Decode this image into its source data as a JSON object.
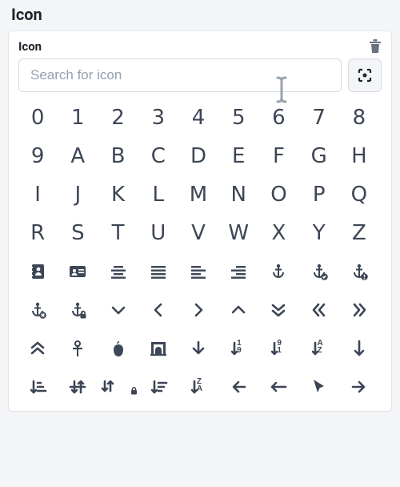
{
  "section": {
    "title": "Icon"
  },
  "panel": {
    "label": "Icon"
  },
  "search": {
    "placeholder": "Search for icon",
    "value": ""
  },
  "colors": {
    "icon": "#3d4656"
  },
  "icons": [
    {
      "name": "digit-0",
      "kind": "glyph",
      "glyph": "0"
    },
    {
      "name": "digit-1",
      "kind": "glyph",
      "glyph": "1"
    },
    {
      "name": "digit-2",
      "kind": "glyph",
      "glyph": "2"
    },
    {
      "name": "digit-3",
      "kind": "glyph",
      "glyph": "3"
    },
    {
      "name": "digit-4",
      "kind": "glyph",
      "glyph": "4"
    },
    {
      "name": "digit-5",
      "kind": "glyph",
      "glyph": "5"
    },
    {
      "name": "digit-6",
      "kind": "glyph",
      "glyph": "6"
    },
    {
      "name": "digit-7",
      "kind": "glyph",
      "glyph": "7"
    },
    {
      "name": "digit-8",
      "kind": "glyph",
      "glyph": "8"
    },
    {
      "name": "digit-9",
      "kind": "glyph",
      "glyph": "9"
    },
    {
      "name": "letter-a",
      "kind": "glyph",
      "glyph": "A"
    },
    {
      "name": "letter-b",
      "kind": "glyph",
      "glyph": "B"
    },
    {
      "name": "letter-c",
      "kind": "glyph",
      "glyph": "C"
    },
    {
      "name": "letter-d",
      "kind": "glyph",
      "glyph": "D"
    },
    {
      "name": "letter-e",
      "kind": "glyph",
      "glyph": "E"
    },
    {
      "name": "letter-f",
      "kind": "glyph",
      "glyph": "F"
    },
    {
      "name": "letter-g",
      "kind": "glyph",
      "glyph": "G"
    },
    {
      "name": "letter-h",
      "kind": "glyph",
      "glyph": "H"
    },
    {
      "name": "letter-i",
      "kind": "glyph",
      "glyph": "I"
    },
    {
      "name": "letter-j",
      "kind": "glyph",
      "glyph": "J"
    },
    {
      "name": "letter-k",
      "kind": "glyph",
      "glyph": "K"
    },
    {
      "name": "letter-l",
      "kind": "glyph",
      "glyph": "L"
    },
    {
      "name": "letter-m",
      "kind": "glyph",
      "glyph": "M"
    },
    {
      "name": "letter-n",
      "kind": "glyph",
      "glyph": "N"
    },
    {
      "name": "letter-o",
      "kind": "glyph",
      "glyph": "O"
    },
    {
      "name": "letter-p",
      "kind": "glyph",
      "glyph": "P"
    },
    {
      "name": "letter-q",
      "kind": "glyph",
      "glyph": "Q"
    },
    {
      "name": "letter-r",
      "kind": "glyph",
      "glyph": "R"
    },
    {
      "name": "letter-s",
      "kind": "glyph",
      "glyph": "S"
    },
    {
      "name": "letter-t",
      "kind": "glyph",
      "glyph": "T"
    },
    {
      "name": "letter-u",
      "kind": "glyph",
      "glyph": "U"
    },
    {
      "name": "letter-v",
      "kind": "glyph",
      "glyph": "V"
    },
    {
      "name": "letter-w",
      "kind": "glyph",
      "glyph": "W"
    },
    {
      "name": "letter-x",
      "kind": "glyph",
      "glyph": "X"
    },
    {
      "name": "letter-y",
      "kind": "glyph",
      "glyph": "Y"
    },
    {
      "name": "letter-z",
      "kind": "glyph",
      "glyph": "Z"
    },
    {
      "name": "address-book-icon",
      "kind": "svg",
      "svg": "address-book"
    },
    {
      "name": "address-card-icon",
      "kind": "svg",
      "svg": "address-card"
    },
    {
      "name": "align-center-icon",
      "kind": "svg",
      "svg": "align-center"
    },
    {
      "name": "align-justify-icon",
      "kind": "svg",
      "svg": "align-justify"
    },
    {
      "name": "align-left-icon",
      "kind": "svg",
      "svg": "align-left"
    },
    {
      "name": "align-right-icon",
      "kind": "svg",
      "svg": "align-right"
    },
    {
      "name": "anchor-icon",
      "kind": "svg",
      "svg": "anchor"
    },
    {
      "name": "anchor-check-icon",
      "kind": "svg",
      "svg": "anchor-check"
    },
    {
      "name": "anchor-exclamation-icon",
      "kind": "svg",
      "svg": "anchor-excl"
    },
    {
      "name": "anchor-xmark-icon",
      "kind": "svg",
      "svg": "anchor-x"
    },
    {
      "name": "anchor-lock-icon",
      "kind": "svg",
      "svg": "anchor-lock"
    },
    {
      "name": "angle-down-icon",
      "kind": "svg",
      "svg": "angle-down"
    },
    {
      "name": "angle-left-icon",
      "kind": "svg",
      "svg": "angle-left"
    },
    {
      "name": "angle-right-icon",
      "kind": "svg",
      "svg": "angle-right"
    },
    {
      "name": "angle-up-icon",
      "kind": "svg",
      "svg": "angle-up"
    },
    {
      "name": "angles-down-icon",
      "kind": "svg",
      "svg": "angles-down"
    },
    {
      "name": "angles-left-icon",
      "kind": "svg",
      "svg": "angles-left"
    },
    {
      "name": "angles-right-icon",
      "kind": "svg",
      "svg": "angles-right"
    },
    {
      "name": "angles-up-icon",
      "kind": "svg",
      "svg": "angles-up"
    },
    {
      "name": "ankh-icon",
      "kind": "svg",
      "svg": "ankh"
    },
    {
      "name": "apple-icon",
      "kind": "svg",
      "svg": "apple"
    },
    {
      "name": "archway-icon",
      "kind": "svg",
      "svg": "archway"
    },
    {
      "name": "arrow-down-icon",
      "kind": "svg",
      "svg": "arrow-down"
    },
    {
      "name": "arrow-down-1-9-icon",
      "kind": "svg",
      "svg": "arrow-down-19"
    },
    {
      "name": "arrow-down-9-1-icon",
      "kind": "svg",
      "svg": "arrow-down-91"
    },
    {
      "name": "arrow-down-a-z-icon",
      "kind": "svg",
      "svg": "arrow-down-az"
    },
    {
      "name": "arrow-down-long-icon",
      "kind": "svg",
      "svg": "arrow-down-long"
    },
    {
      "name": "arrow-down-short-wide-icon",
      "kind": "svg",
      "svg": "arrow-down-sw"
    },
    {
      "name": "arrow-down-up-across-icon",
      "kind": "svg",
      "svg": "arrow-down-up"
    },
    {
      "name": "arrow-down-up-lock-icon",
      "kind": "svg",
      "svg": "arrow-down-up-lock"
    },
    {
      "name": "arrow-down-wide-short-icon",
      "kind": "svg",
      "svg": "arrow-down-ws"
    },
    {
      "name": "arrow-down-z-a-icon",
      "kind": "svg",
      "svg": "arrow-down-za"
    },
    {
      "name": "arrow-left-icon",
      "kind": "svg",
      "svg": "arrow-left"
    },
    {
      "name": "arrow-left-long-icon",
      "kind": "svg",
      "svg": "arrow-left-long"
    },
    {
      "name": "arrow-pointer-icon",
      "kind": "svg",
      "svg": "arrow-pointer"
    },
    {
      "name": "arrow-right-icon",
      "kind": "svg",
      "svg": "arrow-right"
    }
  ]
}
